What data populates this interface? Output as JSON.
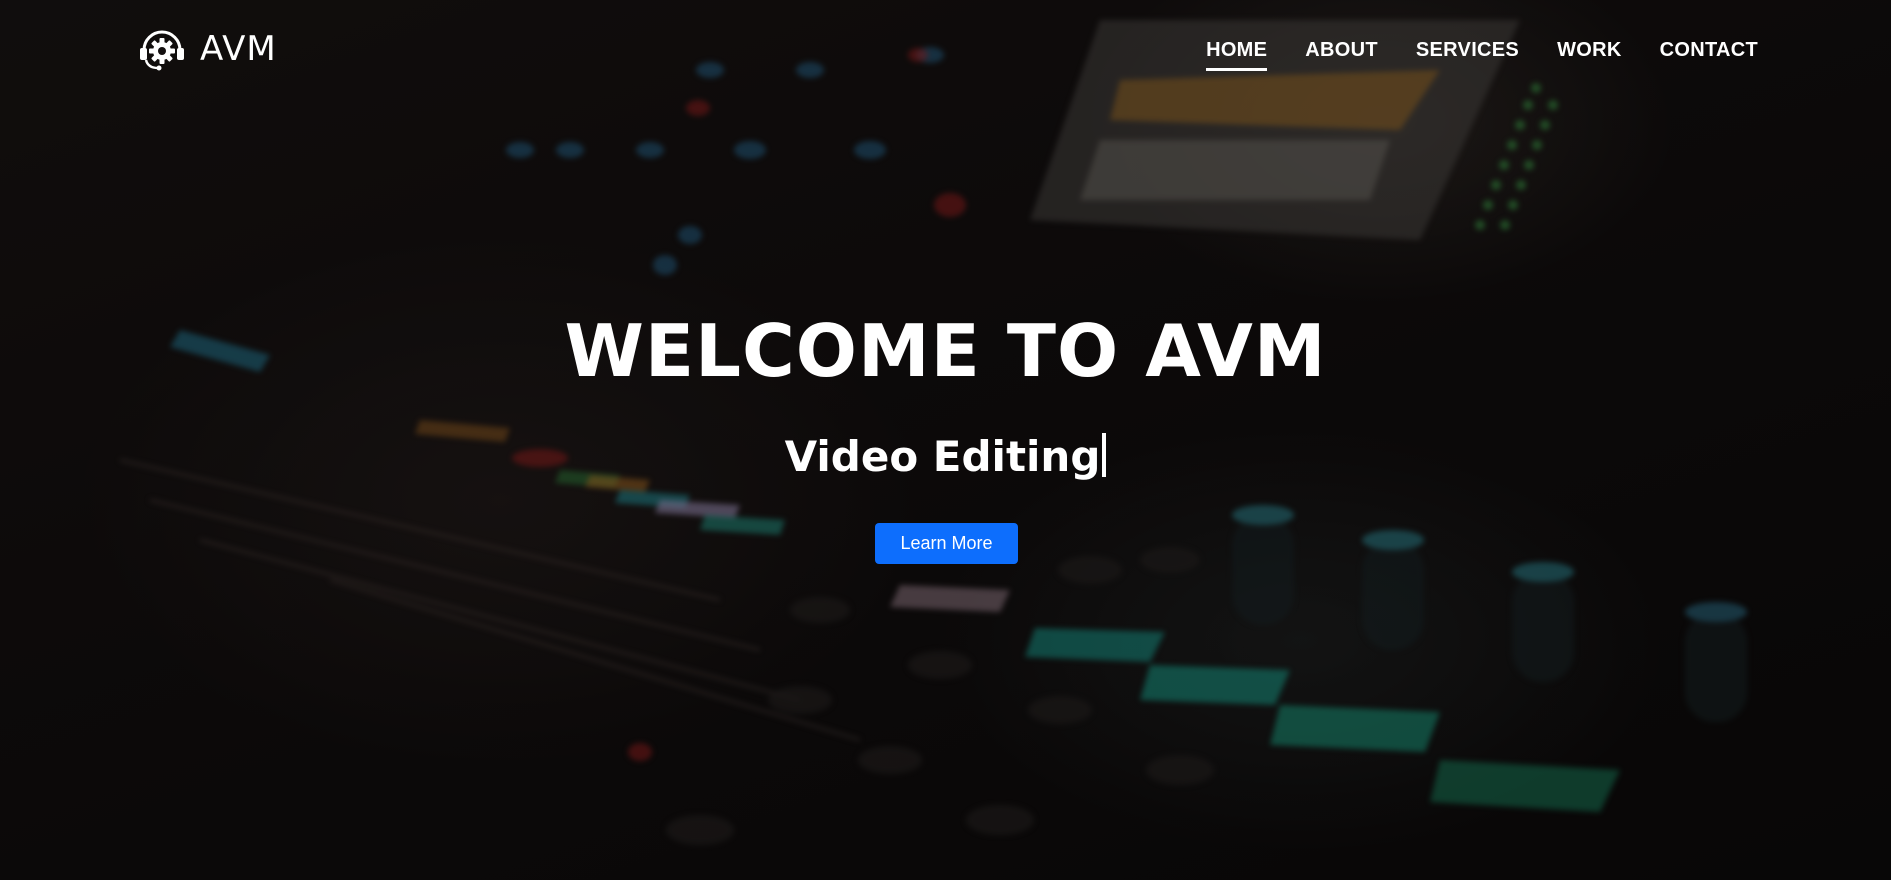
{
  "brand": {
    "name": "AVM",
    "icon": "gear-headset-icon"
  },
  "nav": {
    "items": [
      {
        "label": "HOME",
        "active": true
      },
      {
        "label": "ABOUT",
        "active": false
      },
      {
        "label": "SERVICES",
        "active": false
      },
      {
        "label": "WORK",
        "active": false
      },
      {
        "label": "CONTACT",
        "active": false
      }
    ]
  },
  "hero": {
    "title": "WELCOME TO AVM",
    "typed_text": "Video Editing",
    "cta_label": "Learn More",
    "background_image": "blurred-audio-mixing-console"
  },
  "colors": {
    "accent": "#0d6efd",
    "text": "#ffffff",
    "background": "#0b0909"
  }
}
